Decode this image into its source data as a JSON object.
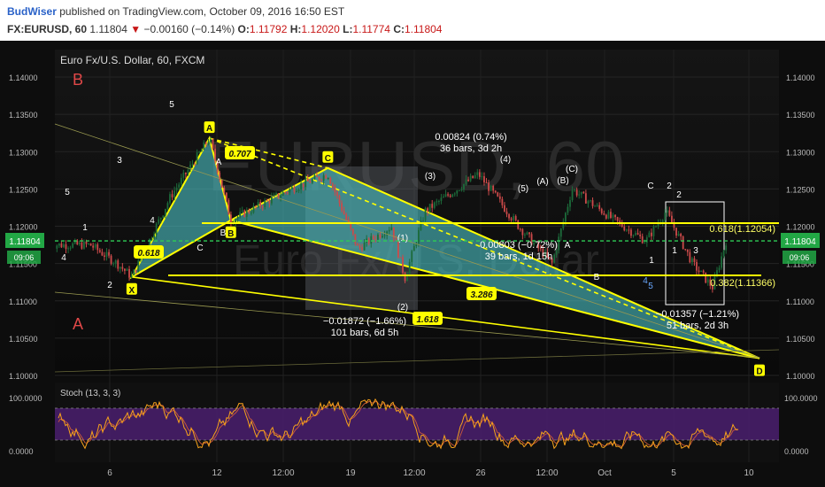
{
  "header": {
    "publisher": "BudWiser",
    "published_text": "published on TradingView.com, October 09, 2016 16:50 EST",
    "symbol": "FX:EURUSD, 60",
    "last": "1.11804",
    "change_arrow": "▼",
    "change": "−0.00160 (−0.14%)",
    "open_label": "O:",
    "open": "1.11792",
    "high_label": "H:",
    "high": "1.12020",
    "low_label": "L:",
    "low": "1.11774",
    "close_label": "C:",
    "close": "1.11804"
  },
  "chart_title": "Euro Fx/U.S. Dollar, 60, FXCM",
  "watermark": {
    "line1": "EURUSD, 60",
    "line2": "Euro Fx/U.S. Dollar"
  },
  "colors": {
    "harmonic_fill": "#4cc3c7",
    "harmonic_line": "#ffff00",
    "candle_up": "#1c6b3a",
    "candle_down": "#cc4a4a",
    "price_badge": "#22a745",
    "stoch_k": "#f7a21b",
    "stoch_band": "#4a1f6e",
    "chart_bg": "#0f0f0f"
  },
  "chart_data": {
    "type": "candlestick",
    "price_axis": {
      "ticks": [
        "1.14000",
        "1.13500",
        "1.13000",
        "1.12500",
        "1.12000",
        "1.11500",
        "1.11000",
        "1.10500",
        "1.10000"
      ],
      "current_price": "1.11804",
      "current_time": "09:06"
    },
    "time_axis": {
      "ticks": [
        "6",
        "12",
        "12:00",
        "19",
        "12:00",
        "26",
        "12:00",
        "Oct",
        "5",
        "10"
      ]
    },
    "pattern_points": [
      {
        "label": "X",
        "t": 0.062,
        "price": 1.1132
      },
      {
        "label": "A",
        "t": 0.178,
        "price": 1.1318
      },
      {
        "label": "B",
        "t": 0.21,
        "price": 1.1208
      },
      {
        "label": "C",
        "t": 0.355,
        "price": 1.1278
      },
      {
        "label": "D",
        "t": 1.0,
        "price": 1.1023
      }
    ],
    "harmonic_ratios": [
      "0.618",
      "0.707",
      "3.286",
      "1.618"
    ],
    "measures": [
      {
        "text": "0.00824 (0.74%)",
        "sub": "36 bars, 3d 2h"
      },
      {
        "text": "−0.01872 (−1.66%)",
        "sub": "101 bars, 6d 5h"
      },
      {
        "text": "0.00803 (−0.72%)",
        "sub": "39 bars, 1d 15h"
      },
      {
        "text": "−0.01357 (−1.21%)",
        "sub": "51 bars, 2d 3h"
      }
    ],
    "fib_labels": [
      "0.618(1.12054)",
      "0.382(1.11366)"
    ],
    "wave_labels": [
      "5",
      "1",
      "4",
      "2",
      "3",
      "5",
      "4",
      "A",
      "B",
      "C",
      "2",
      "1",
      "(1)",
      "(2)",
      "(3)",
      "(4)",
      "(5)",
      "(A)",
      "(B)",
      "(C)",
      "A",
      "B",
      "C",
      "1",
      "2",
      "3",
      "4",
      "5"
    ],
    "big_labels": {
      "top": "B",
      "bottom": "A"
    },
    "stochastic": {
      "title": "Stoch (13, 3, 3)",
      "ticks": [
        "100.0000",
        "0.0000"
      ],
      "upper_band": 80,
      "lower_band": 20
    }
  }
}
